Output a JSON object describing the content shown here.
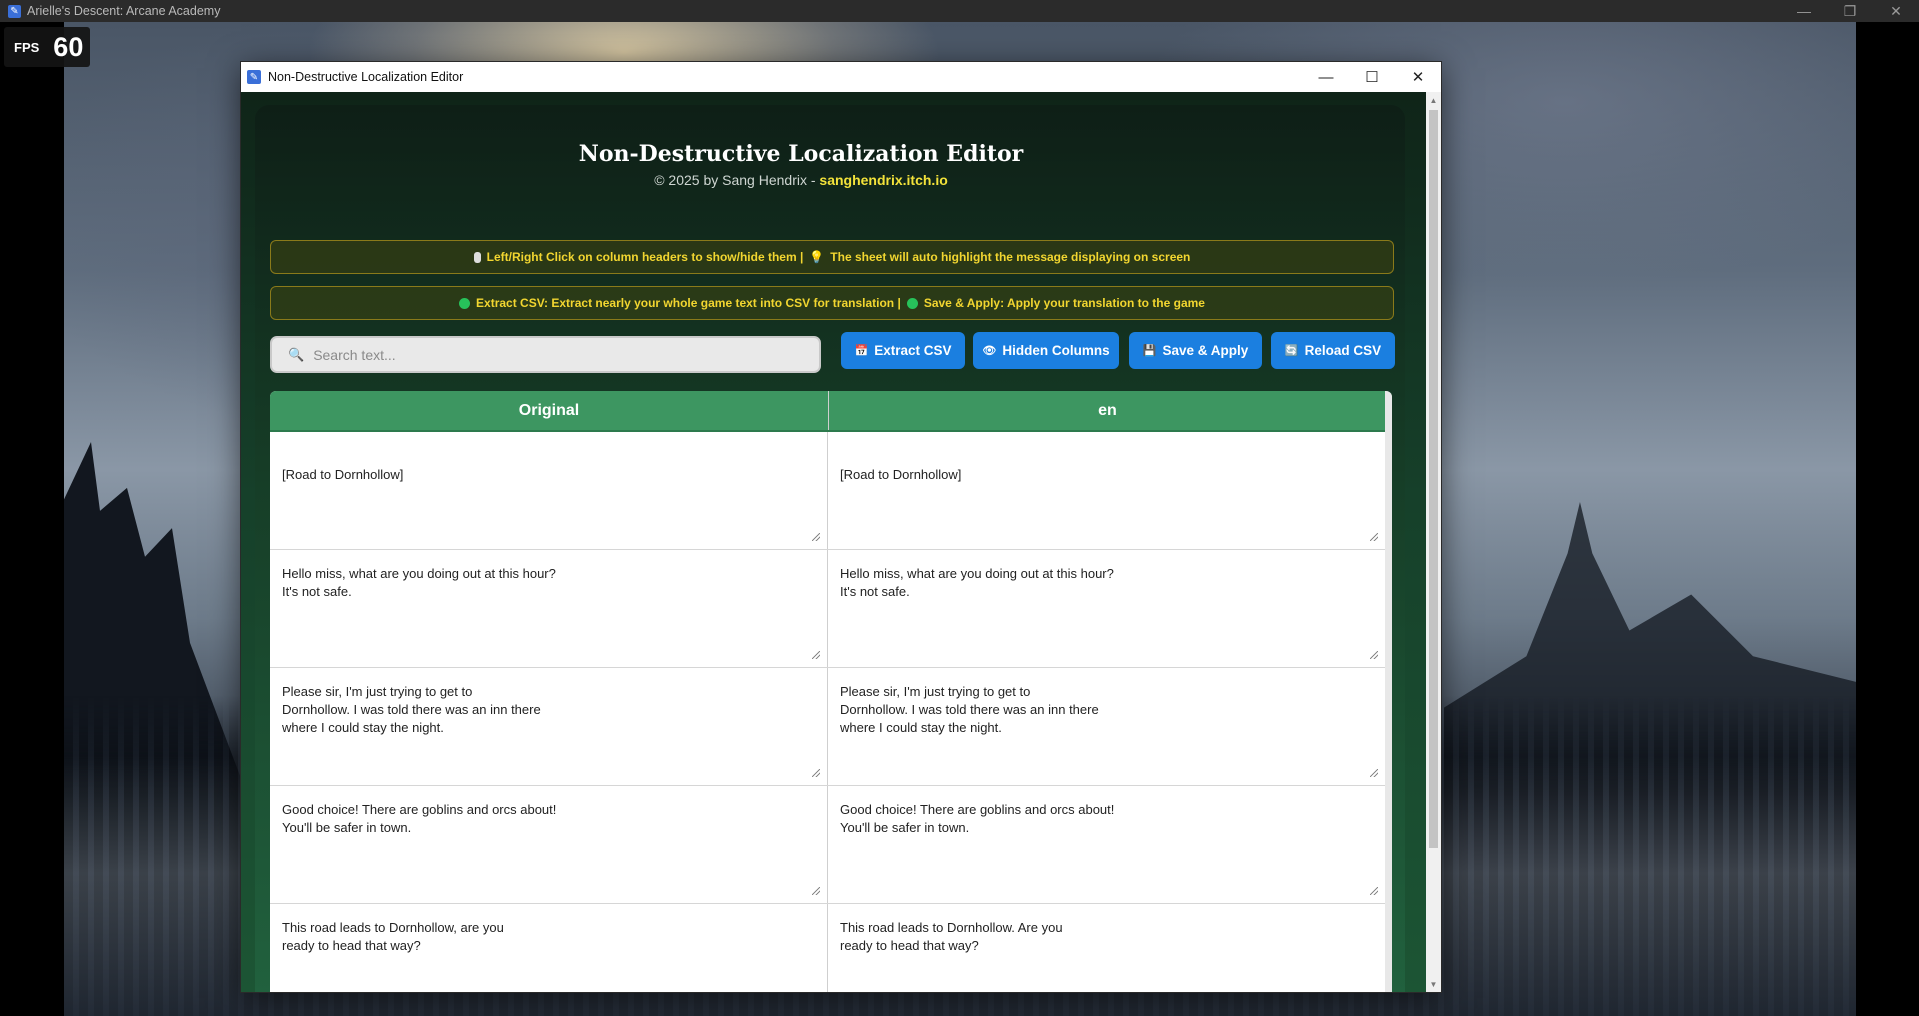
{
  "game_window": {
    "title": "Arielle's Descent: Arcane Academy",
    "controls": [
      "minimize",
      "restore",
      "close"
    ]
  },
  "fps": {
    "label": "FPS",
    "value": "60"
  },
  "editor": {
    "window_title": "Non-Destructive Localization Editor",
    "title": "Non-Destructive Localization Editor",
    "subtitle_prefix": "© 2025 by Sang Hendrix - ",
    "subtitle_link": "sanghendrix.itch.io",
    "notice1": {
      "part1": "Left/Right Click on column headers to show/hide them |",
      "part2": "The sheet will auto highlight the message displaying on screen"
    },
    "notice2": {
      "part1": "Extract CSV: Extract nearly your whole game text into CSV for translation |",
      "part2": "Save & Apply: Apply your translation to the game"
    },
    "search": {
      "placeholder": "Search text..."
    },
    "buttons": {
      "extract": "Extract CSV",
      "hidden": "Hidden Columns",
      "save": "Save & Apply",
      "reload": "Reload CSV"
    },
    "columns": [
      "Original",
      "en"
    ],
    "rows": [
      {
        "original": "[Road to Dornhollow]",
        "en": "[Road to Dornhollow]"
      },
      {
        "original": "Hello miss, what are you doing out at this hour?\nIt's not safe.",
        "en": "Hello miss, what are you doing out at this hour?\nIt's not safe."
      },
      {
        "original": "Please sir, I'm just trying to get to\nDornhollow. I was told there was an inn there\nwhere I could stay the night.",
        "en": "Please sir, I'm just trying to get to\nDornhollow. I was told there was an inn there\nwhere I could stay the night."
      },
      {
        "original": "Good choice! There are goblins and orcs about!\nYou'll be safer in town.",
        "en": "Good choice! There are goblins and orcs about!\nYou'll be safer in town."
      },
      {
        "original": "This road leads to Dornhollow, are you\nready to head that way?",
        "en": "This road leads to Dornhollow. Are you\nready to head that way?"
      }
    ]
  },
  "colors": {
    "accent_button": "#1b7fe0",
    "header_green": "#3d9661",
    "notice_text": "#f2d630",
    "link_yellow": "#f3e23a"
  }
}
